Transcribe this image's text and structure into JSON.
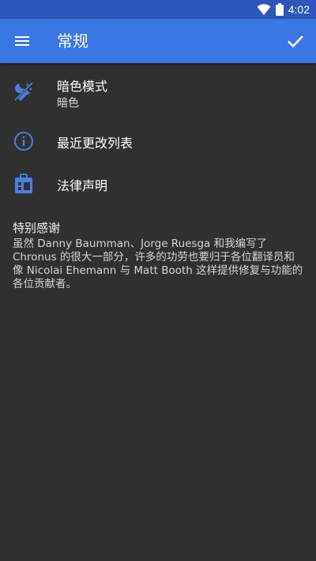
{
  "status_bar": {
    "time": "4:02",
    "icons": [
      "wifi-icon",
      "battery-icon"
    ],
    "color": "#2c56ba"
  },
  "app_bar": {
    "title": "常规",
    "menu_icon": "hamburger-menu-icon",
    "action_icon": "check-icon",
    "color": "#3a77e5"
  },
  "settings": [
    {
      "title": "暗色模式",
      "subtitle": "暗色",
      "icon": "dark-mode-icon"
    },
    {
      "title": "最近更改列表",
      "icon": "info-icon"
    },
    {
      "title": "法律声明",
      "icon": "legal-icon"
    }
  ],
  "thanks": {
    "title": "特别感谢",
    "body": "虽然 Danny Baumman、Jorge Ruesga 和我编写了 Chronus 的很大一部分，许多的功劳也要归于各位翻译员和像 Nicolai Ehemann 与 Matt Booth 这样提供修复与功能的各位贡献者。"
  },
  "colors": {
    "background": "#303030",
    "icon_accent": "#4a7fe0"
  }
}
